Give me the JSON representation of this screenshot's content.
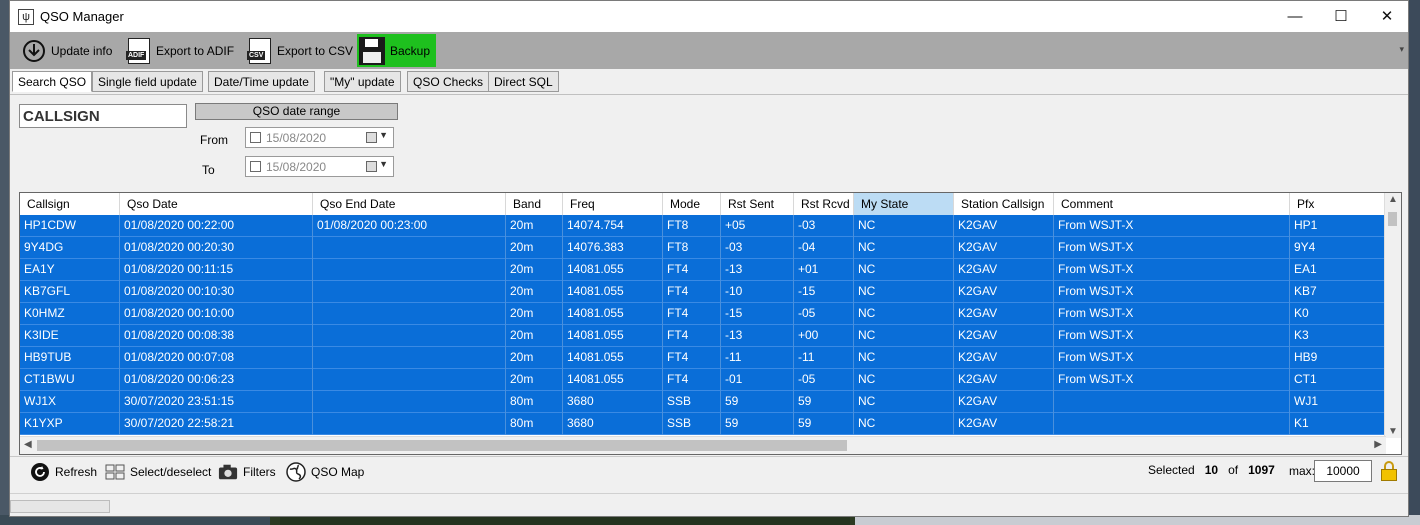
{
  "window": {
    "title": "QSO Manager",
    "minimize_glyph": "—",
    "maximize_glyph": "☐",
    "close_glyph": "✕"
  },
  "toolbar": {
    "update_info": "Update info",
    "export_adif": "Export to ADIF",
    "adif_badge": "ADIF",
    "export_csv": "Export to CSV",
    "csv_badge": "CSV",
    "backup": "Backup",
    "backup_color": "#1ec01e"
  },
  "tabs": [
    "Search QSO",
    "Single field update",
    "Date/Time update",
    "\"My\" update",
    "QSO Checks",
    "Direct SQL"
  ],
  "active_tab": "Search QSO",
  "search": {
    "callsign_value": "CALLSIGN",
    "range_title": "QSO date range",
    "from_label": "From",
    "to_label": "To",
    "from_value": "15/08/2020",
    "to_value": "15/08/2020"
  },
  "grid": {
    "columns": [
      "Callsign",
      "Qso Date",
      "Qso End Date",
      "Band",
      "Freq",
      "Mode",
      "Rst Sent",
      "Rst Rcvd",
      "My State",
      "Station Callsign",
      "Comment",
      "Pfx"
    ],
    "highlighted_column": "My State",
    "selection_color": "#0a6ed8",
    "rows": [
      [
        "HP1CDW",
        "01/08/2020 00:22:00",
        "01/08/2020 00:23:00",
        "20m",
        "14074.754",
        "FT8",
        "+05",
        "-03",
        "NC",
        "K2GAV",
        "From WSJT-X",
        "HP1"
      ],
      [
        "9Y4DG",
        "01/08/2020 00:20:30",
        "",
        "20m",
        "14076.383",
        "FT8",
        "-03",
        "-04",
        "NC",
        "K2GAV",
        "From WSJT-X",
        "9Y4"
      ],
      [
        "EA1Y",
        "01/08/2020 00:11:15",
        "",
        "20m",
        "14081.055",
        "FT4",
        "-13",
        "+01",
        "NC",
        "K2GAV",
        "From WSJT-X",
        "EA1"
      ],
      [
        "KB7GFL",
        "01/08/2020 00:10:30",
        "",
        "20m",
        "14081.055",
        "FT4",
        "-10",
        "-15",
        "NC",
        "K2GAV",
        "From WSJT-X",
        "KB7"
      ],
      [
        "K0HMZ",
        "01/08/2020 00:10:00",
        "",
        "20m",
        "14081.055",
        "FT4",
        "-15",
        "-05",
        "NC",
        "K2GAV",
        "From WSJT-X",
        "K0"
      ],
      [
        "K3IDE",
        "01/08/2020 00:08:38",
        "",
        "20m",
        "14081.055",
        "FT4",
        "-13",
        "+00",
        "NC",
        "K2GAV",
        "From WSJT-X",
        "K3"
      ],
      [
        "HB9TUB",
        "01/08/2020 00:07:08",
        "",
        "20m",
        "14081.055",
        "FT4",
        "-11",
        "-11",
        "NC",
        "K2GAV",
        "From WSJT-X",
        "HB9"
      ],
      [
        "CT1BWU",
        "01/08/2020 00:06:23",
        "",
        "20m",
        "14081.055",
        "FT4",
        "-01",
        "-05",
        "NC",
        "K2GAV",
        "From WSJT-X",
        "CT1"
      ],
      [
        "WJ1X",
        "30/07/2020 23:51:15",
        "",
        "80m",
        "3680",
        "SSB",
        "59",
        "59",
        "NC",
        "K2GAV",
        "",
        "WJ1"
      ],
      [
        "K1YXP",
        "30/07/2020 22:58:21",
        "",
        "80m",
        "3680",
        "SSB",
        "59",
        "59",
        "NC",
        "K2GAV",
        "",
        "K1"
      ]
    ]
  },
  "bottombar": {
    "refresh": "Refresh",
    "select_deselect": "Select/deselect",
    "filters": "Filters",
    "qso_map": "QSO Map",
    "selected_label": "Selected",
    "selected_count": "10",
    "of_label": "of",
    "total_count": "1097",
    "max_label": "max:",
    "max_value": "10000"
  }
}
